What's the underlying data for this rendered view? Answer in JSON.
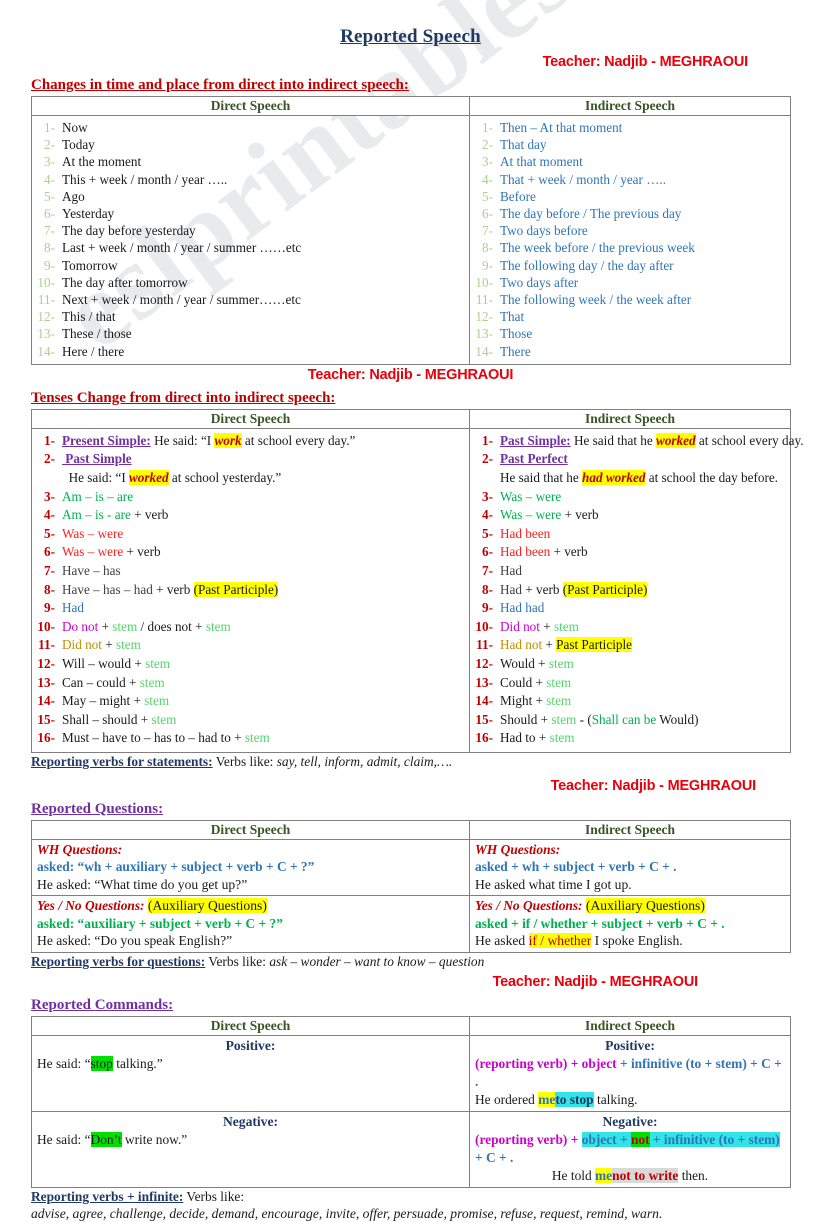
{
  "document": {
    "title": "Reported Speech",
    "watermark": "eslprintables.com",
    "teacher_credit": "Teacher: Nadjib - MEGHRAOUI"
  },
  "colors": {
    "title": "#1F3864",
    "teacher": "#E8000B",
    "section_heading_red": "#C00000",
    "section_heading_purple": "#7030A0",
    "column_header": "#375623",
    "indirect_blue": "#2E75B6",
    "highlight_yellow": "#FFFF00",
    "highlight_green": "#00E000",
    "highlight_cyan": "#32E3E8"
  },
  "section1": {
    "heading": "Changes in time and place from direct into indirect speech:",
    "col_direct": "Direct Speech",
    "col_indirect": "Indirect Speech",
    "rows": [
      {
        "n": "1-",
        "direct": "Now",
        "indirect": "Then – At that moment"
      },
      {
        "n": "2-",
        "direct": "Today",
        "indirect": "That day"
      },
      {
        "n": "3-",
        "direct": "At the moment",
        "indirect": "At that moment"
      },
      {
        "n": "4-",
        "direct": "This + week / month / year …..",
        "indirect": "That + week / month / year ….."
      },
      {
        "n": "5-",
        "direct": "Ago",
        "indirect": "Before"
      },
      {
        "n": "6-",
        "direct": "Yesterday",
        "indirect": "The day before  / The previous day"
      },
      {
        "n": "7-",
        "direct": "The day before yesterday",
        "indirect": "Two days before"
      },
      {
        "n": "8-",
        "direct": "Last + week / month / year / summer ……etc",
        "indirect": "The week before  / the previous week"
      },
      {
        "n": "9-",
        "direct": "Tomorrow",
        "indirect": "The following day / the day after"
      },
      {
        "n": "10-",
        "direct": "The day after tomorrow",
        "indirect": "Two days after"
      },
      {
        "n": "11-",
        "direct": "Next + week / month / year / summer……etc",
        "indirect": "The following week / the week after"
      },
      {
        "n": "12-",
        "direct": "This / that",
        "indirect": "That"
      },
      {
        "n": "13-",
        "direct": "These / those",
        "indirect": "Those"
      },
      {
        "n": "14-",
        "direct": "Here / there",
        "indirect": "There"
      }
    ]
  },
  "section2": {
    "heading": "Tenses Change from direct into indirect speech:",
    "col_direct": "Direct Speech",
    "col_indirect": "Indirect Speech",
    "row1": {
      "n": "1-",
      "direct_label": "Present Simple:",
      "direct_rest_a": " He said: “I ",
      "direct_hl": "work",
      "direct_rest_b": " at school every day.”",
      "indirect_label": "Past Simple:",
      "indirect_rest_a": " He said that he ",
      "indirect_hl": "worked",
      "indirect_rest_b": " at school every day."
    },
    "row2": {
      "n": "2-",
      "direct_label": "Past Simple",
      "direct_example_a": "He said: “I ",
      "direct_example_hl": "worked",
      "direct_example_b": " at school yesterday.”",
      "indirect_label": "Past Perfect",
      "indirect_example_a": "He said that he ",
      "indirect_example_hl": "had worked",
      "indirect_example_b": " at school the day before."
    },
    "rows": [
      {
        "n": "3-",
        "direct": "Am – is – are",
        "direct_color": "green",
        "indirect": "Was – were",
        "indirect_color": "green"
      },
      {
        "n": "4-",
        "direct": "Am – is  - are",
        "direct_color": "green",
        "direct_tail": " + verb",
        "indirect": "Was – were",
        "indirect_color": "green",
        "indirect_tail": " + verb"
      },
      {
        "n": "5-",
        "direct": "Was – were",
        "direct_color": "red",
        "indirect": "Had been",
        "indirect_color": "red"
      },
      {
        "n": "6-",
        "direct": "Was – were",
        "direct_color": "red",
        "direct_tail": " + verb",
        "indirect": "Had been",
        "indirect_color": "red",
        "indirect_tail": " + verb"
      },
      {
        "n": "7-",
        "direct": "Have – has",
        "direct_color": "dark",
        "indirect": "Had",
        "indirect_color": "dark"
      },
      {
        "n": "8-",
        "direct": "Have – has – had",
        "direct_color": "dark",
        "direct_tail": " + verb ",
        "direct_hl": "(Past Participle)",
        "indirect": "Had",
        "indirect_color": "dark",
        "indirect_tail": " + verb ",
        "indirect_hl": "(Past Participle)"
      },
      {
        "n": "9-",
        "direct": "Had",
        "direct_color": "blue",
        "indirect": "Had had",
        "indirect_color": "blue"
      },
      {
        "n": "10-",
        "direct": "Do not",
        "direct_color": "magenta",
        "direct_stem": " + stem / does not + stem",
        "indirect": "Did not",
        "indirect_color": "magenta",
        "indirect_stem": " + stem"
      },
      {
        "n": "11-",
        "direct": "Did not",
        "direct_color": "olive",
        "direct_stem": " + stem",
        "indirect": "Had not",
        "indirect_color": "olive",
        "indirect_tail": " + ",
        "indirect_hl": "Past Participle"
      },
      {
        "n": "12-",
        "direct": "Will – would",
        "direct_color": "black",
        "direct_stem": " + stem",
        "indirect": "Would",
        "indirect_color": "black",
        "indirect_stem": " + stem"
      },
      {
        "n": "13-",
        "direct": "Can – could",
        "direct_color": "black",
        "direct_stem": " + stem",
        "indirect": "Could",
        "indirect_color": "black",
        "indirect_stem": " + stem"
      },
      {
        "n": "14-",
        "direct": "May – might",
        "direct_color": "black",
        "direct_stem": " + stem",
        "indirect": "Might",
        "indirect_color": "black",
        "indirect_stem": " + stem"
      },
      {
        "n": "15-",
        "direct": "Shall – should",
        "direct_color": "black",
        "direct_stem": " + stem",
        "indirect": "Should",
        "indirect_color": "black",
        "indirect_stem": " + stem",
        "indirect_note": "  - (Shall can be Would)"
      },
      {
        "n": "16-",
        "direct": "Must – have to – has to – had to",
        "direct_color": "black",
        "direct_stem": " + stem",
        "indirect": "Had to",
        "indirect_color": "black",
        "indirect_stem": " + stem"
      }
    ],
    "note_label": "Reporting verbs for statements:",
    "note_text": " Verbs like: ",
    "note_italic": "say, tell, inform, admit, claim,…."
  },
  "section3": {
    "heading": "Reported Questions:",
    "col_direct": "Direct Speech",
    "col_indirect": "Indirect Speech",
    "wh_label": "WH Questions:",
    "wh_direct_formula": "asked: “wh + auxiliary + subject + verb + C + ?”",
    "wh_direct_example": "He asked: “What time do you get up?”",
    "wh_indirect_formula": "asked + wh + subject + verb + C + .",
    "wh_indirect_example": "He asked what time I got up.",
    "yn_label_direct": "Yes / No Questions:",
    "yn_label_indirect": "Yes / No Questions:",
    "yn_hl": "(Auxiliary Questions)",
    "yn_direct_formula": "asked: “auxiliary + subject + verb + C + ?”",
    "yn_direct_example": "He asked: “Do you speak English?”",
    "yn_indirect_formula": "asked + if / whether + subject + verb + C + .",
    "yn_indirect_example_a": "He asked ",
    "yn_indirect_example_hl": "if / whether",
    "yn_indirect_example_b": " I spoke English.",
    "note_label": "Reporting verbs for questions:",
    "note_text": " Verbs like: ",
    "note_italic": "ask – wonder – want to know – question"
  },
  "section4": {
    "heading": "Reported Commands:",
    "col_direct": "Direct Speech",
    "col_indirect": "Indirect Speech",
    "positive_label": "Positive:",
    "negative_label": "Negative:",
    "pos_direct_a": "He said: “",
    "pos_direct_hl": "stop",
    "pos_direct_b": " talking.”",
    "pos_indirect_formula_a": "(reporting verb) + object",
    "pos_indirect_formula_b": " + infinitive (to + stem) + C + .",
    "pos_indirect_example_a": "He ordered ",
    "pos_indirect_example_me": "me",
    "pos_indirect_example_tostop": "to stop",
    "pos_indirect_example_b": " talking.",
    "neg_direct_a": "He said: “",
    "neg_direct_hl": "Don’t",
    "neg_direct_b": " write now.”",
    "neg_indirect_formula_a": "(reporting verb) + ",
    "neg_indirect_formula_obj": "object + ",
    "neg_indirect_formula_not": "not",
    "neg_indirect_formula_inf": " + infinitive (to + stem)",
    "neg_indirect_formula_b": " + C + .",
    "neg_indirect_example_a": "He told ",
    "neg_indirect_example_me": "me",
    "neg_indirect_example_not": "not to write",
    "neg_indirect_example_b": " then.",
    "note_label": "Reporting verbs + infinite:",
    "note_text": " Verbs like:",
    "note_list": "advise, agree, challenge, decide, demand, encourage, invite, offer, persuade, promise, refuse, request, remind, warn."
  }
}
